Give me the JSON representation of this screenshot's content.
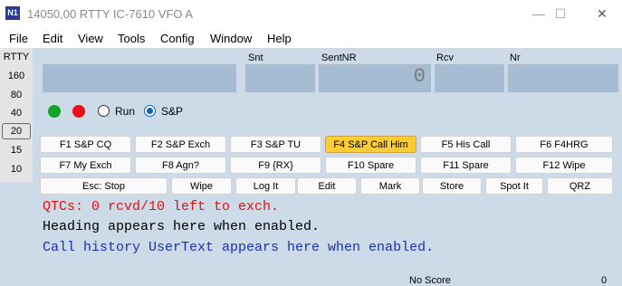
{
  "window": {
    "logo_text": "N1",
    "title": "14050,00 RTTY IC-7610 VFO A",
    "minimize": "—",
    "maximize": "☐",
    "close": "✕"
  },
  "menu": [
    "File",
    "Edit",
    "View",
    "Tools",
    "Config",
    "Window",
    "Help"
  ],
  "bands": {
    "mode": "RTTY",
    "items": [
      "160",
      "80",
      "40",
      "20",
      "15",
      "10"
    ],
    "selected": "20"
  },
  "fields": {
    "snt_label": "Snt",
    "sentnr_label": "SentNR",
    "sentnr_value": "0",
    "rcv_label": "Rcv",
    "nr_label": "Nr"
  },
  "mode_select": {
    "run_label": "Run",
    "sp_label": "S&P",
    "selected": "S&P",
    "green_color": "#13a328",
    "red_color": "#e8101b"
  },
  "function_keys_row1": [
    "F1 S&P CQ",
    "F2 S&P Exch",
    "F3 S&P TU",
    "F4 S&P Call Him",
    "F5 His Call",
    "F6 F4HRG"
  ],
  "function_keys_row2": [
    "F7 My Exch",
    "F8 Agn?",
    "F9 {RX}",
    "F10 Spare",
    "F11 Spare",
    "F12 Wipe"
  ],
  "action_buttons": [
    "Esc: Stop",
    "Wipe",
    "Log It",
    "Edit",
    "Mark",
    "Store",
    "Spot It",
    "QRZ"
  ],
  "highlighted_key": "F4 S&P Call Him",
  "info": {
    "qtc_line": "QTCs: 0 rcvd/10 left to exch.",
    "heading_line": "Heading appears here when enabled.",
    "call_history_line": "Call history UserText appears here when enabled.",
    "qtc_color": "#e31010",
    "call_history_color": "#1a2fb5"
  },
  "status": {
    "score": "No Score",
    "count": "0"
  }
}
